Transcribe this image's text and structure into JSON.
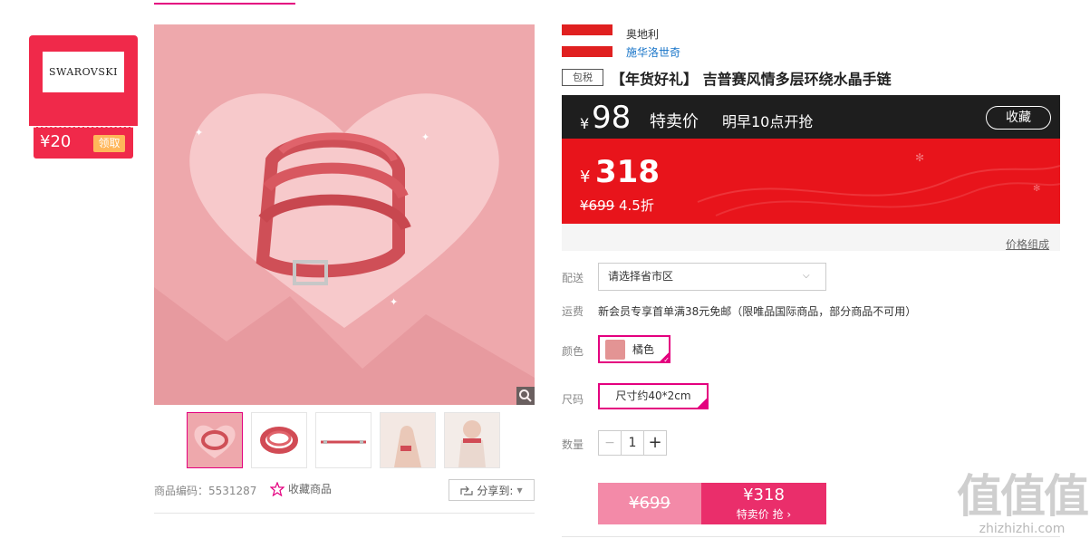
{
  "colors": {
    "accent": "#e4007f",
    "price_red": "#e8141b",
    "dark_bar": "#1e1e1e",
    "brand_red": "#f0294a"
  },
  "brand_panel": {
    "logo_text": "SWAROVSKI",
    "coupon_value": "¥20",
    "coupon_button": "领取"
  },
  "gallery": {
    "zoom_icon": "magnifier-icon",
    "thumbnails_count": 5
  },
  "product_meta": {
    "code_label": "商品编码：5531287",
    "favorite_label": "收藏商品",
    "share_label": "分享到:"
  },
  "origin": {
    "country": "奥地利",
    "brand": "施华洛世奇"
  },
  "header": {
    "tax_badge": "包税",
    "title": "【年货好礼】 吉普赛风情多层环绕水晶手链"
  },
  "promo": {
    "symbol": "¥",
    "price": "98",
    "label": "特卖价",
    "start_time": "明早10点开抢",
    "collect_button": "收藏"
  },
  "current": {
    "symbol": "¥",
    "price": "318",
    "original": "¥699",
    "discount": "4.5折"
  },
  "price_compose": "价格组成",
  "shipping": {
    "label": "配送",
    "select_text": "请选择省市区"
  },
  "freight": {
    "label": "运费",
    "text": "新会员专享首单满38元免邮（限唯品国际商品，部分商品不可用）"
  },
  "color": {
    "label": "颜色",
    "option": "橘色"
  },
  "size": {
    "label": "尺码",
    "option": "尺寸约40*2cm"
  },
  "quantity": {
    "label": "数量",
    "minus": "−",
    "value": "1",
    "plus": "+"
  },
  "buy": {
    "original": "¥699",
    "price": "¥318",
    "label": "特卖价 抢 ›"
  },
  "watermark": {
    "big": "值值值",
    "small": "zhizhizhi.com"
  }
}
